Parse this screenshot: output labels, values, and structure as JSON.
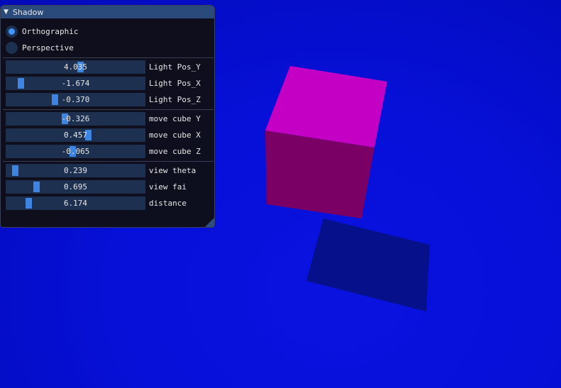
{
  "window": {
    "title": "Shadow",
    "collapse_glyph": "▼"
  },
  "projection": {
    "options": [
      {
        "label": "Orthographic",
        "selected": true
      },
      {
        "label": "Perspective",
        "selected": false
      }
    ]
  },
  "light": [
    {
      "label": "Light Pos_Y",
      "value": "4.035",
      "fraction": 0.54
    },
    {
      "label": "Light Pos_X",
      "value": "-1.674",
      "fraction": 0.08
    },
    {
      "label": "Light Pos_Z",
      "value": "-0.370",
      "fraction": 0.34
    }
  ],
  "cube": [
    {
      "label": "move cube Y",
      "value": "-0.326",
      "fraction": 0.42
    },
    {
      "label": "move cube X",
      "value": "0.457",
      "fraction": 0.6
    },
    {
      "label": "move cube Z",
      "value": "-0.065",
      "fraction": 0.48
    }
  ],
  "view": [
    {
      "label": "view theta",
      "value": "0.239",
      "fraction": 0.04
    },
    {
      "label": "view fai",
      "value": "0.695",
      "fraction": 0.2
    },
    {
      "label": "distance",
      "value": "6.174",
      "fraction": 0.14
    }
  ],
  "scene": {
    "background_color": "#0610d8",
    "cube_top_color": "#c400c4",
    "cube_front_color": "#7a0066",
    "shadow_color": "#050c80"
  }
}
